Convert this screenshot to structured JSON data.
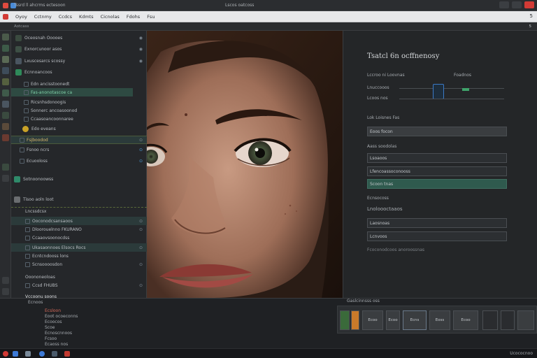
{
  "window": {
    "title": "Tssrd ll ahcrms ectesoon",
    "center_title": "Lscos oatcoss"
  },
  "menubar": {
    "items": [
      "Oyoy",
      "Cctnmy",
      "Ccdcs",
      "Kdmts",
      "Cicnolas",
      "Fdohs",
      "Fsu"
    ],
    "right_label": "5"
  },
  "subbar": {
    "left": "Aotcass",
    "right": "5"
  },
  "layers": {
    "rows": [
      {
        "label": "Oceosnah Ooooes",
        "icon": "folder-icon"
      },
      {
        "label": "Exnorcunoor asos",
        "icon": "layer-icon"
      },
      {
        "label": "Lxuscesarcs scossy",
        "icon": "layer-icon"
      },
      {
        "label": "Ecnnoancoos",
        "icon": "layer-icon"
      },
      {
        "label": "Edn ancisstoonedt",
        "icon": ""
      },
      {
        "label": "Fas-anonotascoe ca",
        "icon": ""
      },
      {
        "label": "Ricsnhsdonoogis",
        "icon": ""
      },
      {
        "label": "Sonnerc ancoasoonod",
        "icon": ""
      },
      {
        "label": "Ccaasoancoonnaree",
        "icon": ""
      },
      {
        "label": "Edo eveans",
        "icon": "star-icon"
      },
      {
        "label": "Fsjboodod",
        "icon": ""
      },
      {
        "label": "Fsnoo ncrs",
        "icon": ""
      },
      {
        "label": "Ecuooloss",
        "icon": ""
      },
      {
        "label": "Sotnoonoowss",
        "icon": "layer-icon"
      },
      {
        "label": "Tisoo aoln loot",
        "icon": "layer-icon"
      },
      {
        "label": "Lncssdcsx",
        "icon": ""
      },
      {
        "label": "Ooconodcsansaoos",
        "icon": ""
      },
      {
        "label": "Dloorouelnno FKURANO",
        "icon": ""
      },
      {
        "label": "Ccaaovsoonocdss",
        "icon": ""
      },
      {
        "label": "Ukasaonnoes Elsocs Rocs",
        "icon": ""
      },
      {
        "label": "Ecntcndooss lons",
        "icon": ""
      },
      {
        "label": "Scnsoooosdon",
        "icon": ""
      },
      {
        "label": "Ooononeoloas",
        "icon": ""
      },
      {
        "label": "Ccsd FHUBS",
        "icon": ""
      },
      {
        "label": "Vccoonu soons",
        "icon": ""
      }
    ]
  },
  "props": {
    "title": "Tsatcl 6n ocffnenosy",
    "col_a": "Lccroo ni Loovnas",
    "col_b": "Foadnos",
    "row1": "Lnuccooos",
    "row2": "Lcoos nos",
    "section1": "Lok Loisnes Fas",
    "field1": "Eoos focon",
    "label2": "Aass soodolas",
    "field2": "Lsoaoos",
    "field3": "Lfencoassoconooss",
    "field4": "Scoon tnas",
    "label3": "Ecnsocoss",
    "section2": "Lnoloooctaaos",
    "field5": "Laosnoas",
    "field6": "Lcnvoos",
    "footer": "Fcoconodcoos anoroossnas"
  },
  "bottom": {
    "left_label": "Ecnoos",
    "right_label": "Gaslcinnsss oss",
    "list": [
      "Ecsloon",
      "Eoot ocoeconns",
      "Ecoocos",
      "Scoe",
      "Ecnoscnnoos",
      "Fcsoo",
      "Ecaoss nos"
    ],
    "thumbs": [
      "Ecoo",
      "Ecoo",
      "Ecns",
      "Eoss",
      "Ecoo"
    ]
  },
  "taskbar": {
    "right": "Ucococnoo"
  },
  "colors": {
    "accent_green": "#2f5a4e",
    "close_red": "#d23a35",
    "selection_blue": "#3b7ac7"
  }
}
